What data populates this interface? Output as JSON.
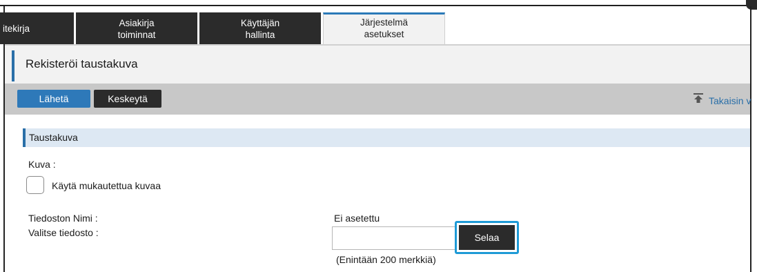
{
  "tabs": [
    {
      "label_line1": "itekirja",
      "label_line2": ""
    },
    {
      "label_line1": "Asiakirja",
      "label_line2": "toiminnat"
    },
    {
      "label_line1": "Käyttäjän",
      "label_line2": "hallinta"
    },
    {
      "label_line1": "Järjestelmä",
      "label_line2": "asetukset"
    }
  ],
  "page": {
    "title": "Rekisteröi taustakuva"
  },
  "toolbar": {
    "send_label": "Lähetä",
    "cancel_label": "Keskeytä",
    "back_label": "Takaisin v"
  },
  "section": {
    "title": "Taustakuva"
  },
  "form": {
    "image_label": "Kuva :",
    "custom_image_checkbox_label": "Käytä mukautettua kuvaa",
    "custom_image_checked": false,
    "file_name_label": "Tiedoston Nimi :",
    "file_name_value": "Ei asetettu",
    "select_file_label": "Valitse tiedosto :",
    "file_input_value": "",
    "browse_label": "Selaa",
    "max_chars_hint": "(Enintään 200 merkkiä)"
  },
  "colors": {
    "accent_blue": "#2a6fa8",
    "button_blue": "#2e79b9",
    "dark_button": "#2b2b2b",
    "focus_ring": "#1e9ad6"
  },
  "icons": {
    "back": "back-to-top-icon"
  }
}
